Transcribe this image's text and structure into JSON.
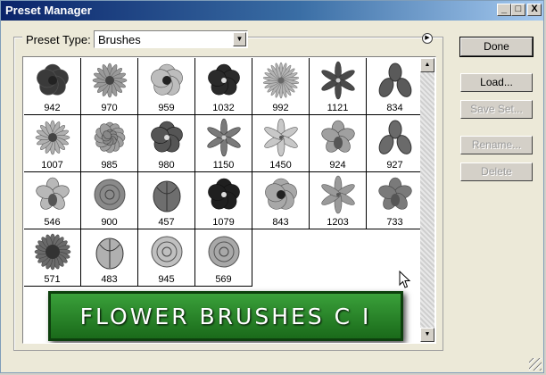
{
  "window": {
    "title": "Preset Manager"
  },
  "titlebar_buttons": {
    "minimize": "_",
    "maximize": "□",
    "close": "X"
  },
  "preset_type": {
    "label": "Preset Type:",
    "value": "Brushes"
  },
  "buttons": {
    "done": "Done",
    "load": "Load...",
    "save_set": "Save Set...",
    "rename": "Rename...",
    "delete": "Delete"
  },
  "brushes": [
    {
      "count": "942",
      "shape": "poppy",
      "shade": "#3a3a3a"
    },
    {
      "count": "970",
      "shape": "daisy",
      "shade": "#9a9a9a"
    },
    {
      "count": "959",
      "shape": "poppy",
      "shade": "#bdbdbd"
    },
    {
      "count": "1032",
      "shape": "pansy",
      "shade": "#2a2a2a"
    },
    {
      "count": "992",
      "shape": "aster",
      "shade": "#b5b5b5"
    },
    {
      "count": "1121",
      "shape": "star",
      "shade": "#4a4a4a"
    },
    {
      "count": "834",
      "shape": "iris",
      "shade": "#5a5a5a"
    },
    {
      "count": "1007",
      "shape": "daisy",
      "shade": "#b0b0b0"
    },
    {
      "count": "985",
      "shape": "carnation",
      "shade": "#9f9f9f"
    },
    {
      "count": "980",
      "shape": "pansy",
      "shade": "#555555"
    },
    {
      "count": "1150",
      "shape": "star",
      "shade": "#7a7a7a"
    },
    {
      "count": "1450",
      "shape": "lily",
      "shade": "#c8c8c8"
    },
    {
      "count": "924",
      "shape": "orchid",
      "shade": "#a0a0a0"
    },
    {
      "count": "927",
      "shape": "iris",
      "shade": "#6a6a6a"
    },
    {
      "count": "546",
      "shape": "orchid",
      "shade": "#b8b8b8"
    },
    {
      "count": "900",
      "shape": "rose",
      "shade": "#8a8a8a"
    },
    {
      "count": "457",
      "shape": "tulip",
      "shade": "#6e6e6e"
    },
    {
      "count": "1079",
      "shape": "pansy",
      "shade": "#1f1f1f"
    },
    {
      "count": "843",
      "shape": "poppy",
      "shade": "#a8a8a8"
    },
    {
      "count": "1203",
      "shape": "lily",
      "shade": "#9a9a9a"
    },
    {
      "count": "733",
      "shape": "orchid",
      "shade": "#7a7a7a"
    },
    {
      "count": "571",
      "shape": "sunflower",
      "shade": "#6a6a6a"
    },
    {
      "count": "483",
      "shape": "tulip",
      "shade": "#b0b0b0"
    },
    {
      "count": "945",
      "shape": "rose",
      "shade": "#c0c0c0"
    },
    {
      "count": "569",
      "shape": "rose",
      "shade": "#a8a8a8"
    }
  ],
  "banner": {
    "text": "FLOWER BRUSHES C I"
  },
  "colors": {
    "title_start": "#0a246a",
    "title_end": "#a6caf0",
    "banner_green": "#2e8b2e"
  }
}
